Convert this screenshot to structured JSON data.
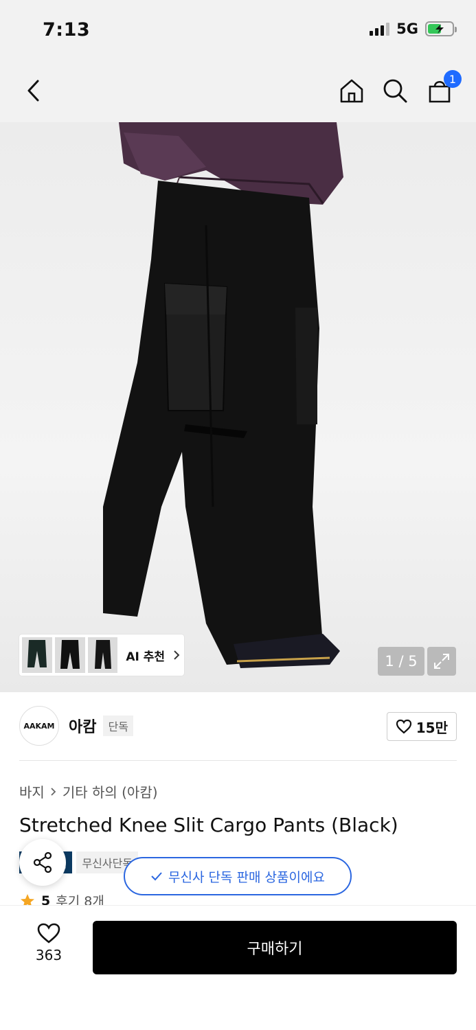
{
  "status_bar": {
    "time": "7:13",
    "network": "5G",
    "battery_level": 0.55
  },
  "nav": {
    "cart_count": "1",
    "icons": [
      "back-icon",
      "home-icon",
      "search-icon",
      "cart-icon"
    ]
  },
  "gallery": {
    "thumbnail_label": "AI 추천",
    "counter": "1 / 5"
  },
  "brand": {
    "logo_text": "AAKAM",
    "name": "아캄",
    "exclusive_tag": "단독",
    "likes": "15만"
  },
  "product": {
    "breadcrumb": [
      "바지",
      "기타 하의 (아캄)"
    ],
    "title": "Stretched Knee Slit Cargo Pants (Black)",
    "tags": [
      "페이",
      "무신사단독"
    ],
    "rating": "5",
    "reviews": "후기 8개"
  },
  "toast": {
    "text": "무신사 단독 판매 상품이에요"
  },
  "bottom": {
    "wish_count": "363",
    "buy_label": "구매하기"
  },
  "colors": {
    "accent": "#1f6bff",
    "toast_blue": "#2a66e0",
    "tag_navy": "#0c3b63",
    "star": "#f5a623"
  }
}
